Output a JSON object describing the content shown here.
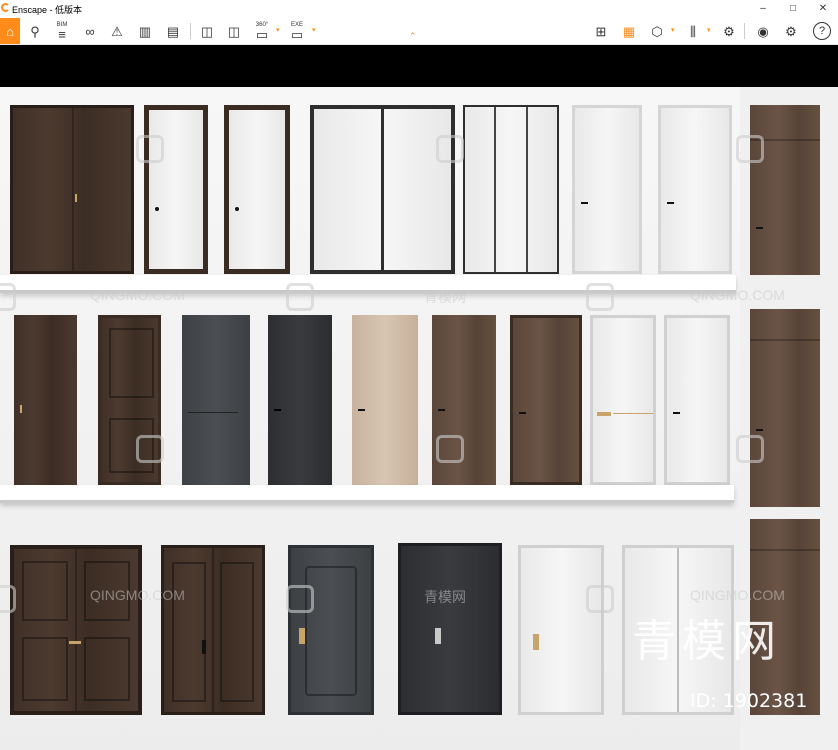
{
  "window": {
    "title": "Enscape - 低版本",
    "controls": [
      "–",
      "□",
      "✕"
    ]
  },
  "toolbar": {
    "items": [
      {
        "id": "home",
        "glyph": "⌂"
      },
      {
        "id": "location",
        "glyph": "⚲"
      },
      {
        "id": "bim",
        "glyph": "≡",
        "label": "BIM"
      },
      {
        "id": "binoculars",
        "glyph": "∞"
      },
      {
        "id": "compass",
        "glyph": "⚠"
      },
      {
        "id": "buildings",
        "glyph": "▥"
      },
      {
        "id": "clapper",
        "glyph": "▤"
      },
      {
        "id": "screenshot",
        "glyph": "◫"
      },
      {
        "id": "batch-render",
        "glyph": "◫"
      },
      {
        "id": "panorama",
        "glyph": "▭",
        "label": "360°"
      },
      {
        "id": "exe-export",
        "glyph": "▭",
        "label": "EXE"
      },
      {
        "id": "web-standalone",
        "glyph": "◷"
      },
      {
        "id": "map",
        "glyph": "⊞"
      },
      {
        "id": "sketch-view",
        "glyph": "▦"
      },
      {
        "id": "cube",
        "glyph": "⬡"
      },
      {
        "id": "books",
        "glyph": "⫼"
      },
      {
        "id": "asset-library",
        "glyph": "⚙"
      },
      {
        "id": "eye",
        "glyph": "◉"
      },
      {
        "id": "settings",
        "glyph": "⚙"
      },
      {
        "id": "help",
        "glyph": "?"
      }
    ],
    "collapse_glyph": "⌃"
  },
  "watermark": {
    "site": "QINGMO.COM",
    "cn": "青模网",
    "big": "青模网",
    "id": "ID: 1902381"
  }
}
